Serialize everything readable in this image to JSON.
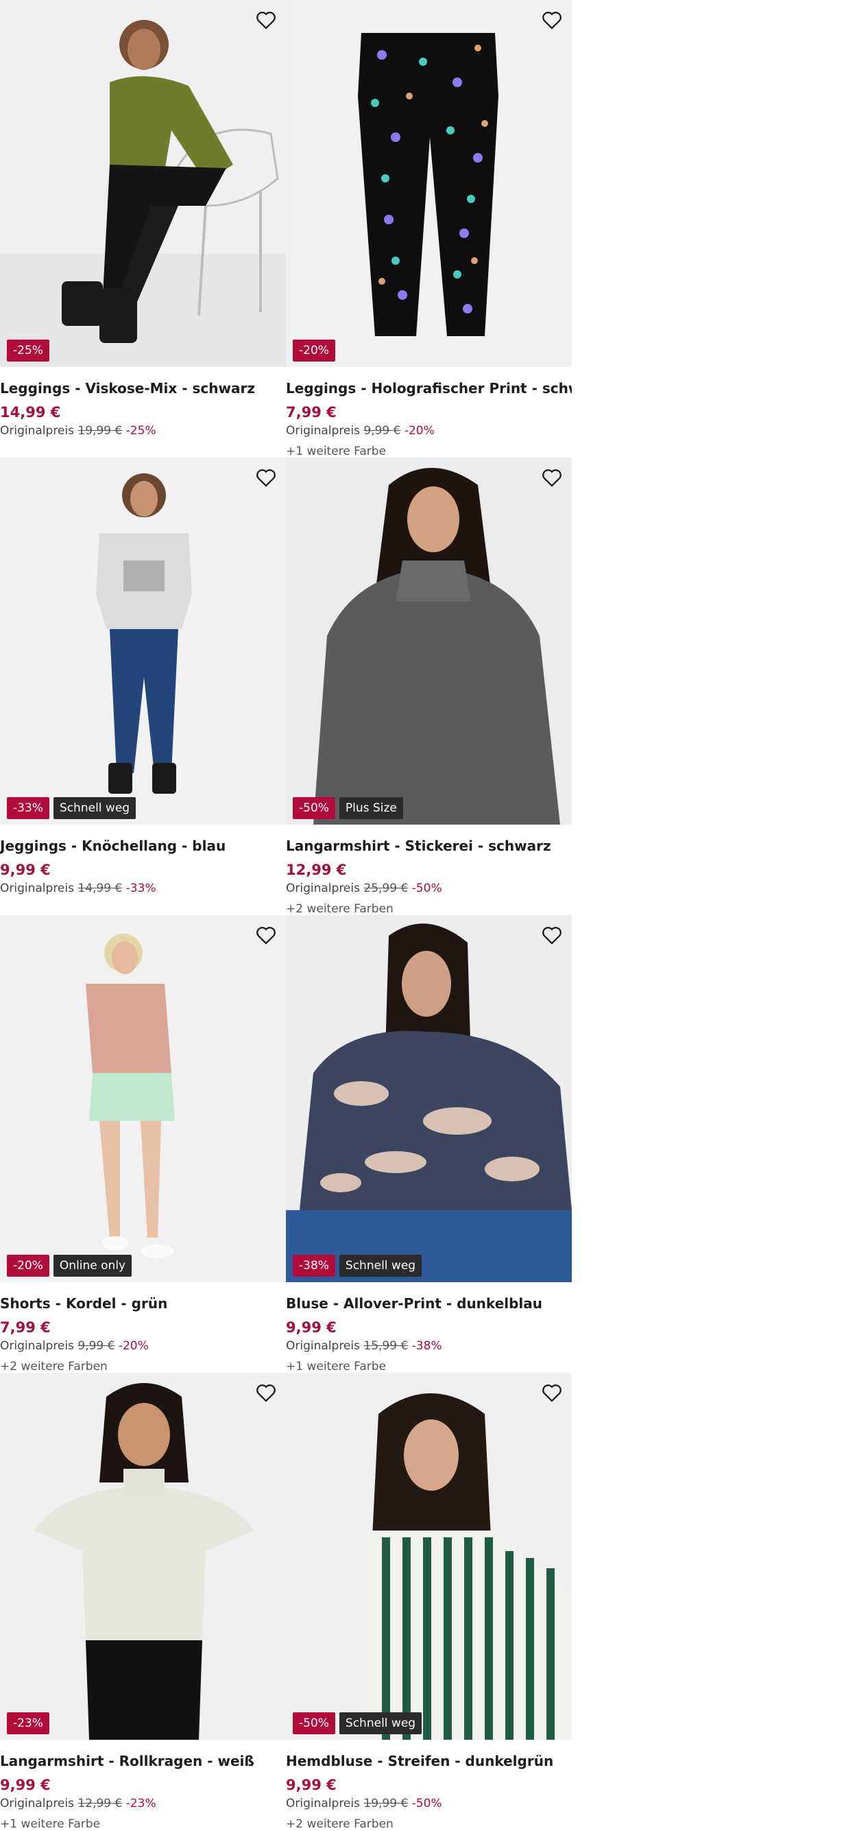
{
  "products": [
    {
      "title": "Leggings - Viskose-Mix - schwarz",
      "price": "14,99 €",
      "orig_label": "Originalpreis",
      "orig_price": "19,99 €",
      "discount": "-25%",
      "badges": [
        "-25%"
      ],
      "colors": "",
      "image": "woman-green-sweater-black-leggings"
    },
    {
      "title": "Leggings - Holografischer Print - schwarz",
      "price": "7,99 €",
      "orig_label": "Originalpreis",
      "orig_price": "9,99 €",
      "discount": "-20%",
      "badges": [
        "-20%"
      ],
      "colors": "+1 weitere Farbe",
      "image": "black-leggings-unicorn-print"
    },
    {
      "title": "Jeggings - Knöchellang - blau",
      "price": "9,99 €",
      "orig_label": "Originalpreis",
      "orig_price": "14,99 €",
      "discount": "-33%",
      "badges": [
        "-33%",
        "Schnell weg"
      ],
      "colors": "",
      "image": "girl-grey-tshirt-blue-jeggings"
    },
    {
      "title": "Langarmshirt - Stickerei - schwarz",
      "price": "12,99 €",
      "orig_label": "Originalpreis",
      "orig_price": "25,99 €",
      "discount": "-50%",
      "badges": [
        "-50%",
        "Plus Size"
      ],
      "colors": "+2 weitere Farben",
      "image": "woman-grey-turtleneck"
    },
    {
      "title": "Shorts - Kordel - grün",
      "price": "7,99 €",
      "orig_label": "Originalpreis",
      "orig_price": "9,99 €",
      "discount": "-20%",
      "badges": [
        "-20%",
        "Online only"
      ],
      "colors": "+2 weitere Farben",
      "image": "woman-pink-tshirt-mint-shorts"
    },
    {
      "title": "Bluse - Allover-Print - dunkelblau",
      "price": "9,99 €",
      "orig_label": "Originalpreis",
      "orig_price": "15,99 €",
      "discount": "-38%",
      "badges": [
        "-38%",
        "Schnell weg"
      ],
      "colors": "+1 weitere Farbe",
      "image": "woman-patterned-blouse"
    },
    {
      "title": "Langarmshirt - Rollkragen - weiß",
      "price": "9,99 €",
      "orig_label": "Originalpreis",
      "orig_price": "12,99 €",
      "discount": "-23%",
      "badges": [
        "-23%"
      ],
      "colors": "+1 weitere Farbe",
      "image": "woman-white-turtleneck"
    },
    {
      "title": "Hemdbluse - Streifen - dunkelgrün",
      "price": "9,99 €",
      "orig_label": "Originalpreis",
      "orig_price": "19,99 €",
      "discount": "-50%",
      "badges": [
        "-50%",
        "Schnell weg"
      ],
      "colors": "+2 weitere Farben",
      "image": "woman-green-striped-shirt"
    }
  ],
  "icons": {
    "wishlist": "heart-outline-icon"
  },
  "colors": {
    "price": "#a3123f",
    "sale_badge": "#b00d3d",
    "tag_badge": "#2b2b2b",
    "image_bg": "#efefef"
  }
}
